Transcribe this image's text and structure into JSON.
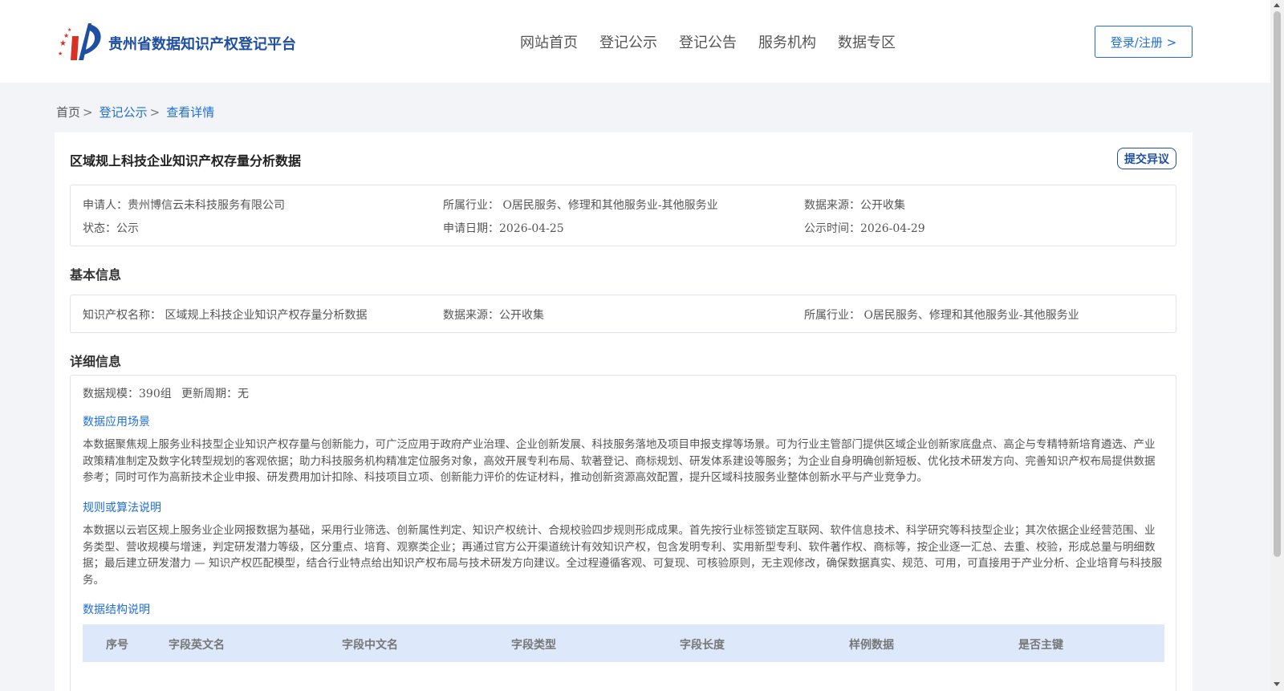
{
  "header": {
    "site_title": "贵州省数据知识产权登记平台",
    "nav": [
      "网站首页",
      "登记公示",
      "登记公告",
      "服务机构",
      "数据专区"
    ],
    "login_label": "登录/注册 >"
  },
  "breadcrumb": {
    "home": "首页",
    "level2": "登记公示",
    "current": "查看详情",
    "separator": ">"
  },
  "detail": {
    "title": "区域规上科技企业知识产权存量分析数据",
    "objection_label": "提交异议",
    "summary": {
      "applicant": "申请人：贵州博信云未科技服务有限公司",
      "industry": "所属行业： O居民服务、修理和其他服务业-其他服务业",
      "source": "数据来源：公开收集",
      "status": "状态：公示",
      "apply_date": "申请日期：2026-04-25",
      "publish_date": "公示时间：2026-04-29"
    },
    "basic_title": "基本信息",
    "basic": {
      "ip_name": "知识产权名称： 区域规上科技企业知识产权存量分析数据",
      "source": "数据来源：公开收集",
      "industry": "所属行业： O居民服务、修理和其他服务业-其他服务业"
    },
    "detail_title": "详细信息",
    "scale": "数据规模：390组",
    "update_cycle": "更新周期：无",
    "scenario_title": "数据应用场景",
    "scenario_text": "本数据聚焦规上服务业科技型企业知识产权存量与创新能力，可广泛应用于政府产业治理、企业创新发展、科技服务落地及项目申报支撑等场景。可为行业主管部门提供区域企业创新家底盘点、高企与专精特新培育遴选、产业政策精准制定及数字化转型规划的客观依据；助力科技服务机构精准定位服务对象，高效开展专利布局、软著登记、商标规划、研发体系建设等服务；为企业自身明确创新短板、优化技术研发方向、完善知识产权布局提供数据参考；同时可作为高新技术企业申报、研发费用加计扣除、科技项目立项、创新能力评价的佐证材料，推动创新资源高效配置，提升区域科技服务业整体创新水平与产业竞争力。",
    "rules_title": "规则或算法说明",
    "rules_text": "本数据以云岩区规上服务业企业网报数据为基础，采用行业筛选、创新属性判定、知识产权统计、合规校验四步规则形成成果。首先按行业标签锁定互联网、软件信息技术、科学研究等科技型企业；其次依据企业经营范围、业务类型、营收规模与增速，判定研发潜力等级，区分重点、培育、观察类企业；再通过官方公开渠道统计有效知识产权，包含发明专利、实用新型专利、软件著作权、商标等，按企业逐一汇总、去重、校验，形成总量与明细数据；最后建立研发潜力 — 知识产权匹配模型，结合行业特点给出知识产权布局与技术研发方向建议。全过程遵循客观、可复现、可核验原则，无主观修改，确保数据真实、规范、可用，可直接用于产业分析、企业培育与科技服务。",
    "structure_title": "数据结构说明",
    "table_headers": [
      "序号",
      "字段英文名",
      "字段中文名",
      "字段类型",
      "字段长度",
      "样例数据",
      "是否主键"
    ]
  },
  "colors": {
    "brand_blue": "#1f4fa0",
    "link_blue": "#1f6fd6",
    "table_head_bg": "#dde9fb"
  }
}
